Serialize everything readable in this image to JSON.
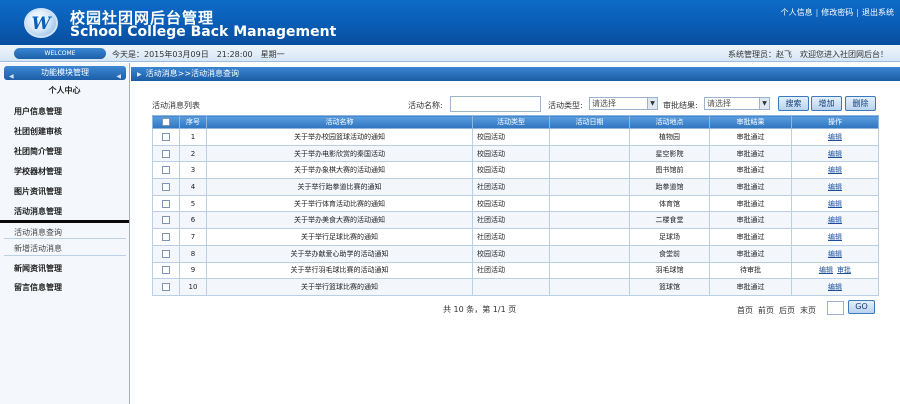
{
  "header": {
    "logo_letter": "W",
    "title_cn": "校园社团网后台管理",
    "title_en": "School College Back Management",
    "links": [
      "个人信息",
      "修改密码",
      "退出系统"
    ],
    "link_sep": "|"
  },
  "infobar": {
    "welcome": "WELCOME",
    "today": "今天是：2015年03月09日　21:28:00　星期一",
    "admin": "系统管理员：赵飞　欢迎您进入社团网后台！"
  },
  "sidebar": {
    "header": "功能模块管理",
    "arrow_left": "◀",
    "arrow_right": "◀",
    "items": [
      {
        "label": "个人中心"
      },
      {
        "label": "用户信息管理"
      },
      {
        "label": "社团创建审核"
      },
      {
        "label": "社团简介管理"
      },
      {
        "label": "学校器材管理"
      },
      {
        "label": "图片资讯管理"
      },
      {
        "label": "活动消息管理"
      },
      {
        "label": "新闻资讯管理"
      },
      {
        "label": "留言信息管理"
      }
    ],
    "sub_items": [
      {
        "label": "活动消息查询"
      },
      {
        "label": "新增活动消息"
      }
    ]
  },
  "breadcrumb": {
    "icon": "▶",
    "text": "活动消息>>活动消息查询"
  },
  "search": {
    "list_title": "活动消息列表",
    "name_label": "活动名称:",
    "type_label": "活动类型:",
    "type_value": "请选择",
    "review_label": "审批结果:",
    "review_value": "请选择",
    "dropdown_icon": "▼",
    "search_btn": "搜索",
    "add_btn": "增加",
    "delete_btn": "删除"
  },
  "table": {
    "headers": [
      "",
      "序号",
      "活动名称",
      "活动类型",
      "活动日期",
      "活动地点",
      "审批结果",
      "操作"
    ],
    "rows": [
      {
        "no": "1",
        "name": "关于举办校园篮球活动的通知",
        "type": "校园活动",
        "date": "",
        "place": "植物园",
        "result": "审批通过",
        "ops": [
          "编辑"
        ]
      },
      {
        "no": "2",
        "name": "关于举办电影欣赏的秦国活动",
        "type": "校园活动",
        "date": "",
        "place": "星空影院",
        "result": "审批通过",
        "ops": [
          "编辑"
        ]
      },
      {
        "no": "3",
        "name": "关于举办象棋大赛的活动通知",
        "type": "校园活动",
        "date": "",
        "place": "图书馆前",
        "result": "审批通过",
        "ops": [
          "编辑"
        ]
      },
      {
        "no": "4",
        "name": "关于举行跆拳道比赛的通知",
        "type": "社团活动",
        "date": "",
        "place": "跆拳道馆",
        "result": "审批通过",
        "ops": [
          "编辑"
        ]
      },
      {
        "no": "5",
        "name": "关于举行体育活动比赛的通知",
        "type": "校园活动",
        "date": "",
        "place": "体育馆",
        "result": "审批通过",
        "ops": [
          "编辑"
        ]
      },
      {
        "no": "6",
        "name": "关于举办美食大赛的活动通知",
        "type": "社团活动",
        "date": "",
        "place": "二楼食堂",
        "result": "审批通过",
        "ops": [
          "编辑"
        ]
      },
      {
        "no": "7",
        "name": "关于举行足球比赛的通知",
        "type": "社团活动",
        "date": "",
        "place": "足球场",
        "result": "审批通过",
        "ops": [
          "编辑"
        ]
      },
      {
        "no": "8",
        "name": "关于举办献爱心助学的活动通知",
        "type": "校园活动",
        "date": "",
        "place": "食堂前",
        "result": "审批通过",
        "ops": [
          "编辑"
        ]
      },
      {
        "no": "9",
        "name": "关于举行羽毛球比赛的活动通知",
        "type": "社团活动",
        "date": "",
        "place": "羽毛球馆",
        "result": "待审批",
        "ops": [
          "编辑",
          "审批"
        ]
      },
      {
        "no": "10",
        "name": "关于举行篮球比赛的通知",
        "type": "",
        "date": "",
        "place": "篮球馆",
        "result": "审批通过",
        "ops": [
          "编辑"
        ]
      }
    ]
  },
  "pagination": {
    "total": "共 10 条，第 1/1 页",
    "first": "首页",
    "prev": "前页",
    "next": "后页",
    "last": "末页",
    "go": "GO"
  }
}
